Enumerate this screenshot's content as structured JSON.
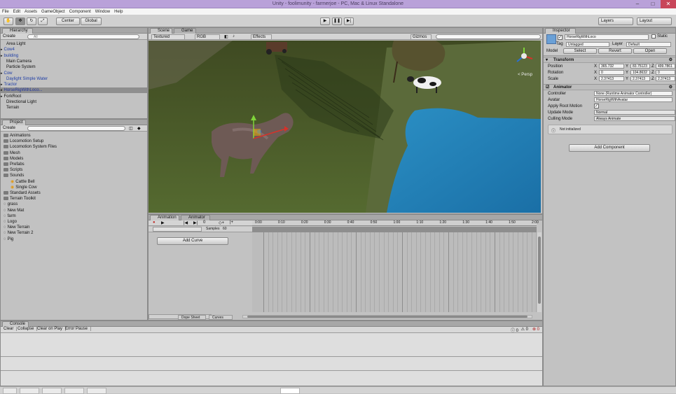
{
  "window": {
    "title": "Unity - foolimunity - farmerjoe - PC, Mac & Linux Standalone"
  },
  "menu": [
    "File",
    "Edit",
    "Assets",
    "GameObject",
    "Component",
    "Window",
    "Help"
  ],
  "toolbar": {
    "pivot_label": "Center",
    "space_label": "Global",
    "layers_label": "Layers",
    "layout_label": "Layout"
  },
  "hierarchy": {
    "tab": "Hierarchy",
    "create_label": "Create",
    "search_placeholder": "All",
    "items": [
      {
        "label": "Area Light",
        "color": "normal",
        "indent": 1
      },
      {
        "label": "Cow4",
        "color": "blue",
        "indent": 0
      },
      {
        "label": "building",
        "color": "blue",
        "indent": 0
      },
      {
        "label": "Main Camera",
        "color": "normal",
        "indent": 1
      },
      {
        "label": "Particle System",
        "color": "normal",
        "indent": 1
      },
      {
        "label": "Cow",
        "color": "blue",
        "indent": 0
      },
      {
        "label": "Daylight Simple Water",
        "color": "blue",
        "indent": 1
      },
      {
        "label": "Tractor",
        "color": "blue",
        "indent": 0
      },
      {
        "label": "HorseRigWithLoco...",
        "color": "selected",
        "indent": 0
      },
      {
        "label": "ForkRoot",
        "color": "normal",
        "indent": 0
      },
      {
        "label": "Directional Light",
        "color": "normal",
        "indent": 1
      },
      {
        "label": "Terrain",
        "color": "normal",
        "indent": 1
      }
    ]
  },
  "project": {
    "tab": "Project",
    "create_label": "Create",
    "items": [
      {
        "label": "Animations",
        "type": "folder",
        "indent": 0
      },
      {
        "label": "Locomotion Setup",
        "type": "folder",
        "indent": 0
      },
      {
        "label": "Locomotion System Files",
        "type": "folder",
        "indent": 0
      },
      {
        "label": "Mesh",
        "type": "folder",
        "indent": 0
      },
      {
        "label": "Models",
        "type": "folder",
        "indent": 0
      },
      {
        "label": "Prefabs",
        "type": "folder",
        "indent": 0
      },
      {
        "label": "Scripts",
        "type": "folder",
        "indent": 0
      },
      {
        "label": "Sounds",
        "type": "folder",
        "indent": 0
      },
      {
        "label": "Cattle Bell",
        "type": "sound",
        "indent": 1
      },
      {
        "label": "Single Cow",
        "type": "sound",
        "indent": 1
      },
      {
        "label": "Standard Assets",
        "type": "folder",
        "indent": 0
      },
      {
        "label": "Terrain Toolkit",
        "type": "folder",
        "indent": 0
      },
      {
        "label": "grass",
        "type": "file",
        "indent": 0
      },
      {
        "label": "New Mat",
        "type": "file",
        "indent": 0
      },
      {
        "label": "farm",
        "type": "file",
        "indent": 0
      },
      {
        "label": "Logo",
        "type": "file",
        "indent": 0
      },
      {
        "label": "New Terrain",
        "type": "file",
        "indent": 0
      },
      {
        "label": "New Terrain 2",
        "type": "file",
        "indent": 0
      },
      {
        "label": "Pig",
        "type": "file",
        "indent": 0
      }
    ]
  },
  "scene": {
    "tabs": [
      "Scene",
      "Game"
    ],
    "shading": "Textured",
    "mode": "RGB",
    "effects_label": "Effects",
    "gizmos_label": "Gizmos",
    "gizmo_label": "< Persp"
  },
  "animation": {
    "tabs": [
      "Animation",
      "Animator"
    ],
    "sample_label": "Samples",
    "sample_value": "60",
    "add_curve_label": "Add Curve",
    "ruler": [
      "0:00",
      "0:10",
      "0:20",
      "0:30",
      "0:40",
      "0:50",
      "1:00",
      "1:10",
      "1:20",
      "1:30",
      "1:40",
      "1:50",
      "2:00"
    ],
    "dope_sheet_label": "Dope Sheet",
    "curves_label": "Curves"
  },
  "console": {
    "tab": "Console",
    "buttons": [
      "Clear",
      "Collapse",
      "Clear on Play",
      "Error Pause"
    ],
    "count_info": "0",
    "count_warn": "0",
    "count_err": "0"
  },
  "inspector": {
    "tab": "Inspector",
    "object_name": "HorseRigWithLoco",
    "static_label": "Static",
    "tag_label": "Tag",
    "tag_value": "Untagged",
    "layer_label": "Layer",
    "layer_value": "Default",
    "model_label": "Model",
    "select_label": "Select",
    "revert_label": "Revert",
    "open_label": "Open",
    "transform": {
      "title": "Transform",
      "position": {
        "label": "Position",
        "x": "365.732",
        "y": "83.75123",
        "z": "499.7861"
      },
      "rotation": {
        "label": "Rotation",
        "x": "0",
        "y": "104.8632",
        "z": "0"
      },
      "scale": {
        "label": "Scale",
        "x": "2.37413",
        "y": "2.37413",
        "z": "2.37413"
      }
    },
    "animator": {
      "title": "Animator",
      "controller_label": "Controller",
      "controller_value": "None (Runtime Animator Controller)",
      "avatar_label": "Avatar",
      "avatar_value": "HorseRigWithAvatar",
      "root_motion_label": "Apply Root Motion",
      "update_mode_label": "Update Mode",
      "update_mode_value": "Normal",
      "culling_label": "Culling Mode",
      "culling_value": "Always Animate",
      "info_text": "Not initialized"
    },
    "add_component_label": "Add Component"
  }
}
